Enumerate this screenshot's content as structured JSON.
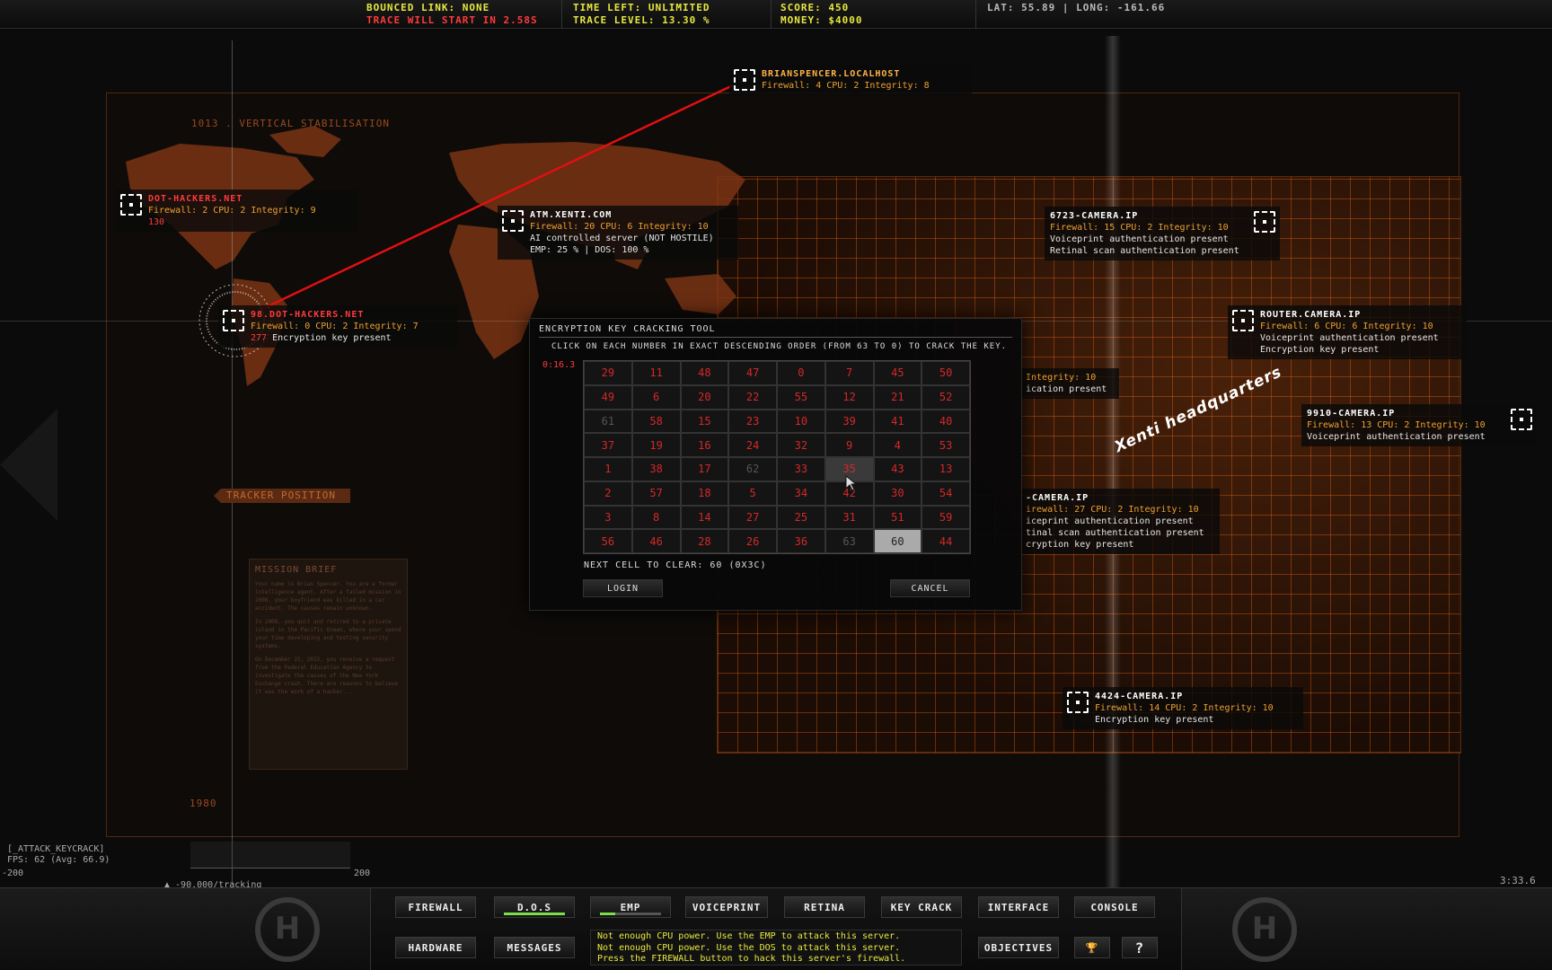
{
  "topbar": {
    "bounced_link": "Bounced link: None",
    "trace_start": "Trace will start in 2.58s",
    "time_left": "Time left: Unlimited",
    "trace_level": "Trace level: 13.30 %",
    "score": "Score: 450",
    "money": "Money: $4000",
    "coords": "Lat: 55.89 | Long: -161.66"
  },
  "map": {
    "stabilisation_label": "1013 . Vertical Stabilisation",
    "tracker_label": "Tracker Position",
    "year_label": "1980",
    "headquarters_label": "Xenti headquarters"
  },
  "nodes": {
    "brianspencer": {
      "title": "brianspencer.localhost",
      "stats": "Firewall: 4 CPU: 2 Integrity: 8"
    },
    "dot_hackers": {
      "title": "dot-hackers.net",
      "stats": "Firewall: 2 CPU: 2 Integrity: 9",
      "alert": "130"
    },
    "atm_xenti": {
      "title": "atm.xenti.com",
      "stats": "Firewall: 20 CPU: 6 Integrity: 10",
      "note1": "AI controlled server (NOT HOSTILE)",
      "note2": "EMP:  25 % | DOS: 100 %"
    },
    "dot_hackers_98": {
      "title": "98.dot-hackers.net",
      "stats": "Firewall: 0 CPU: 2 Integrity: 7",
      "alert": "277",
      "note1": "Encryption key present"
    },
    "camera_6723": {
      "title": "6723-camera.ip",
      "stats": "Firewall: 15 CPU: 2 Integrity: 10",
      "note1": "Voiceprint authentication present",
      "note2": "Retinal scan authentication present"
    },
    "router_camera": {
      "title": "router.camera.ip",
      "stats": "Firewall: 6 CPU: 6 Integrity: 10",
      "note1": "Voiceprint authentication present",
      "note2": "Encryption key present"
    },
    "partial_hidden": {
      "stats": "Integrity: 10",
      "note1": "ication present"
    },
    "camera_9910": {
      "title": "9910-camera.ip",
      "stats": "Firewall: 13 CPU: 2 Integrity: 10",
      "note1": "Voiceprint authentication present"
    },
    "camera_partial": {
      "title": "-camera.ip",
      "stats": "irewall: 27 CPU: 2 Integrity: 10",
      "note1": "iceprint authentication present",
      "note2": "tinal scan authentication present",
      "note3": "cryption key present"
    },
    "camera_4424": {
      "title": "4424-camera.ip",
      "stats": "Firewall: 14 CPU: 2 Integrity: 10",
      "note1": "Encryption key present"
    }
  },
  "mission": {
    "heading": "Mission Brief",
    "p1": "Your name is Brian Spencer. You are a former intelligence agent. After a failed mission in 2008, your boyfriend was killed in a car accident. The causes remain unknown.",
    "p2": "In 2008, you quit and retired to a private island in the Pacific Ocean, where your spend your time developing and testing security systems.",
    "p3": "On December 25, 2015, you receive a request from the Federal Education Agency to investigate the causes of the New York Exchange crash. There are reasons to believe it was the work of a hacker..."
  },
  "dialog": {
    "title": "Encryption key cracking tool",
    "instruction": "Click on each number in exact descending order (from 63 to 0) to crack the key.",
    "timer": "0:16.3",
    "next_cell": "Next cell to clear: 60 (0x3C)",
    "login": "Login",
    "cancel": "Cancel",
    "cells": [
      [
        "29",
        "11",
        "48",
        "47",
        "0",
        "7",
        "45",
        "50"
      ],
      [
        "49",
        "6",
        "20",
        "22",
        "55",
        "12",
        "21",
        "52"
      ],
      [
        "61",
        "58",
        "15",
        "23",
        "10",
        "39",
        "41",
        "40"
      ],
      [
        "37",
        "19",
        "16",
        "24",
        "32",
        "9",
        "4",
        "53"
      ],
      [
        "1",
        "38",
        "17",
        "62",
        "33",
        "35",
        "43",
        "13"
      ],
      [
        "2",
        "57",
        "18",
        "5",
        "34",
        "42",
        "30",
        "54"
      ],
      [
        "3",
        "8",
        "14",
        "27",
        "25",
        "31",
        "51",
        "59"
      ],
      [
        "56",
        "46",
        "28",
        "26",
        "36",
        "63",
        "60",
        "44"
      ]
    ],
    "cleared": [
      "61",
      "62",
      "63"
    ],
    "hover_cell": "35",
    "target_cell": "60"
  },
  "hud": {
    "command": "[_ATTACK_KEYCRACK]",
    "fps": "FPS:  62 (Avg: 66.9)",
    "tick_left": "-200",
    "tick_right": "200",
    "tracking": "▲ -90.000/tracking",
    "clock": "3:33.6"
  },
  "buttons": {
    "firewall": "Firewall",
    "dos": "D.O.S",
    "emp": "EMP",
    "voiceprint": "Voiceprint",
    "retina": "Retina",
    "key_crack": "Key Crack",
    "interface": "Interface",
    "console": "Console",
    "hardware": "Hardware",
    "messages": "Messages",
    "objectives": "Objectives",
    "trophy": "🏆",
    "help": "?"
  },
  "progress": {
    "dos": 1.0,
    "emp": 0.25
  },
  "messages": [
    "Not enough CPU power. Use the EMP to attack this server.",
    "Not enough CPU power. Use the DOS to attack this server.",
    "Press the FIREWALL button to hack this server's firewall."
  ],
  "colors": {
    "accent_orange": "#ff7a1a",
    "alert_red": "#ff3b3b",
    "status_yellow": "#e8e840",
    "progress_green": "#7adf4a"
  }
}
